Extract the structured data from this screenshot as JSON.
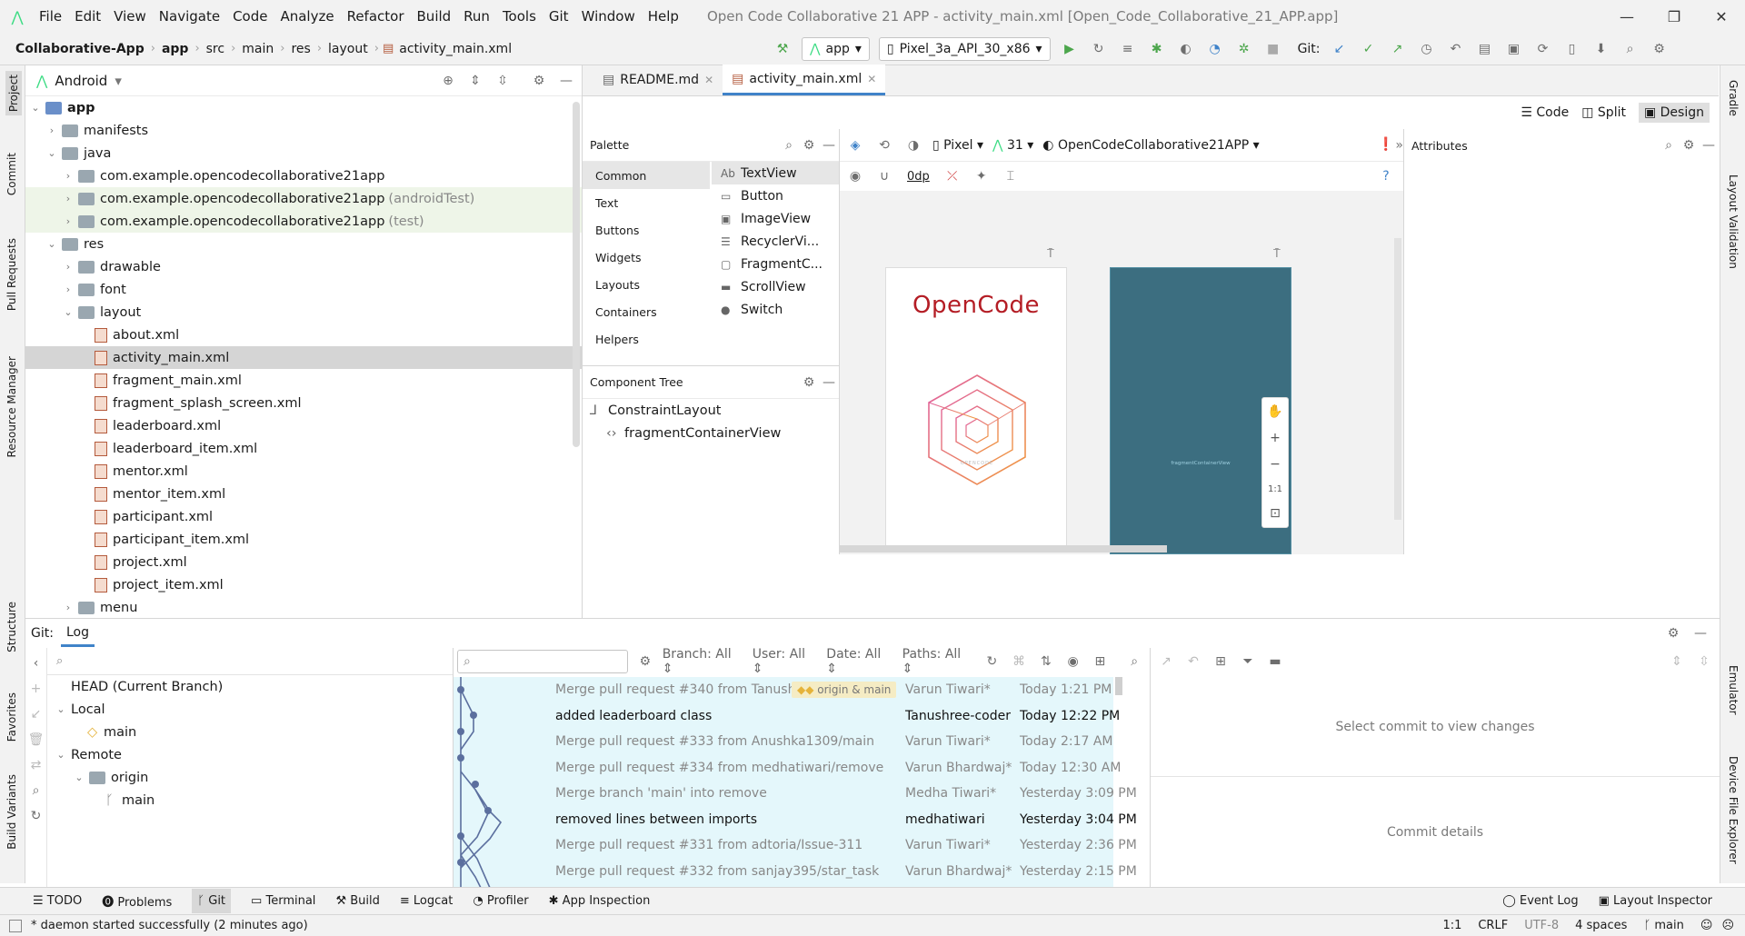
{
  "menu": {
    "items": [
      "File",
      "Edit",
      "View",
      "Navigate",
      "Code",
      "Analyze",
      "Refactor",
      "Build",
      "Run",
      "Tools",
      "Git",
      "Window",
      "Help"
    ],
    "title": "Open Code Collaborative 21 APP - activity_main.xml [Open_Code_Collaborative_21_APP.app]"
  },
  "nav": {
    "crumbs": [
      "Collaborative-App",
      "app",
      "src",
      "main",
      "res",
      "layout",
      "activity_main.xml"
    ],
    "run_config": "app",
    "device": "Pixel_3a_API_30_x86",
    "git_label": "Git:"
  },
  "left_stripe": [
    "Project",
    "Commit",
    "Pull Requests",
    "Resource Manager",
    "Structure",
    "Favorites",
    "Build Variants"
  ],
  "right_stripe": [
    "Gradle",
    "Layout Validation",
    "Emulator",
    "Device File Explorer"
  ],
  "project": {
    "view": "Android",
    "tree": [
      {
        "label": "app",
        "depth": 0,
        "icon": "folder",
        "open": true,
        "bold": true
      },
      {
        "label": "manifests",
        "depth": 1,
        "icon": "folder",
        "open": false
      },
      {
        "label": "java",
        "depth": 1,
        "icon": "folder",
        "open": true
      },
      {
        "label": "com.example.opencodecollaborative21app",
        "depth": 2,
        "icon": "pkg",
        "open": false
      },
      {
        "label": "com.example.opencodecollaborative21app",
        "suffix": "(androidTest)",
        "depth": 2,
        "icon": "pkg",
        "open": false,
        "green": true
      },
      {
        "label": "com.example.opencodecollaborative21app",
        "suffix": "(test)",
        "depth": 2,
        "icon": "pkg",
        "open": false,
        "green": true
      },
      {
        "label": "res",
        "depth": 1,
        "icon": "folder",
        "open": true
      },
      {
        "label": "drawable",
        "depth": 2,
        "icon": "folder",
        "open": false
      },
      {
        "label": "font",
        "depth": 2,
        "icon": "folder",
        "open": false
      },
      {
        "label": "layout",
        "depth": 2,
        "icon": "folder",
        "open": true
      },
      {
        "label": "about.xml",
        "depth": 3,
        "icon": "xml"
      },
      {
        "label": "activity_main.xml",
        "depth": 3,
        "icon": "xml",
        "selected": true
      },
      {
        "label": "fragment_main.xml",
        "depth": 3,
        "icon": "xml"
      },
      {
        "label": "fragment_splash_screen.xml",
        "depth": 3,
        "icon": "xml"
      },
      {
        "label": "leaderboard.xml",
        "depth": 3,
        "icon": "xml"
      },
      {
        "label": "leaderboard_item.xml",
        "depth": 3,
        "icon": "xml"
      },
      {
        "label": "mentor.xml",
        "depth": 3,
        "icon": "xml"
      },
      {
        "label": "mentor_item.xml",
        "depth": 3,
        "icon": "xml"
      },
      {
        "label": "participant.xml",
        "depth": 3,
        "icon": "xml"
      },
      {
        "label": "participant_item.xml",
        "depth": 3,
        "icon": "xml"
      },
      {
        "label": "project.xml",
        "depth": 3,
        "icon": "xml"
      },
      {
        "label": "project_item.xml",
        "depth": 3,
        "icon": "xml"
      },
      {
        "label": "menu",
        "depth": 2,
        "icon": "folder",
        "open": false
      }
    ]
  },
  "editor": {
    "tabs": [
      {
        "label": "README.md",
        "active": false
      },
      {
        "label": "activity_main.xml",
        "active": true
      }
    ],
    "modes": [
      "Code",
      "Split",
      "Design"
    ],
    "palette_title": "Palette",
    "palette_categories": [
      "Common",
      "Text",
      "Buttons",
      "Widgets",
      "Layouts",
      "Containers",
      "Helpers"
    ],
    "palette_widgets": [
      {
        "icon": "Ab",
        "label": "TextView"
      },
      {
        "icon": "▭",
        "label": "Button"
      },
      {
        "icon": "▣",
        "label": "ImageView"
      },
      {
        "icon": "☰",
        "label": "RecyclerVi..."
      },
      {
        "icon": "▢",
        "label": "FragmentC..."
      },
      {
        "icon": "▬",
        "label": "ScrollView"
      },
      {
        "icon": "●",
        "label": "Switch"
      }
    ],
    "component_tree_title": "Component Tree",
    "component_tree": [
      "ConstraintLayout",
      "fragmentContainerView"
    ],
    "design_toolbar": {
      "device": "Pixel",
      "api": "31",
      "theme": "OpenCodeCollaborative21APP",
      "margin": "0dp"
    },
    "preview_text": "OpenCode",
    "blueprint_label": "fragmentContainerView",
    "logo_caption": "OPENCODE",
    "zoom_fit": "1:1",
    "attributes_title": "Attributes"
  },
  "git": {
    "tab_prefix": "Git:",
    "tab_label": "Log",
    "branches": {
      "head": "HEAD (Current Branch)",
      "local": "Local",
      "local_main": "main",
      "remote": "Remote",
      "origin": "origin",
      "origin_main": "main"
    },
    "filters": {
      "branch": "Branch: All",
      "user": "User: All",
      "date": "Date: All",
      "paths": "Paths: All"
    },
    "commits": [
      {
        "msg": "Merge pull request #340 from Tanushree-coder/mai",
        "tag": "origin & main",
        "author": "Varun Tiwari*",
        "date": "Today 1:21 PM",
        "bold": false
      },
      {
        "msg": "added leaderboard class",
        "author": "Tanushree-coder",
        "date": "Today 12:22 PM",
        "bold": true
      },
      {
        "msg": "Merge pull request #333 from Anushka1309/main",
        "author": "Varun Tiwari*",
        "date": "Today 2:17 AM",
        "bold": false
      },
      {
        "msg": "Merge pull request #334 from medhatiwari/remove",
        "author": "Varun Bhardwaj*",
        "date": "Today 12:30 AM",
        "bold": false
      },
      {
        "msg": "Merge branch 'main' into remove",
        "author": "Medha Tiwari*",
        "date": "Yesterday 3:09 PM",
        "bold": false
      },
      {
        "msg": "removed lines between imports",
        "author": "medhatiwari",
        "date": "Yesterday 3:04 PM",
        "bold": true
      },
      {
        "msg": "Merge pull request #331 from adtoria/Issue-311",
        "author": "Varun Tiwari*",
        "date": "Yesterday 2:36 PM",
        "bold": false
      },
      {
        "msg": "Merge pull request #332 from sanjay395/star_task",
        "author": "Varun Bhardwaj*",
        "date": "Yesterday 2:15 PM",
        "bold": false
      }
    ],
    "select_hint": "Select commit to view changes",
    "commit_details": "Commit details"
  },
  "bottom_tools": [
    "TODO",
    "Problems",
    "Git",
    "Terminal",
    "Build",
    "Logcat",
    "Profiler",
    "App Inspection"
  ],
  "bottom_right_tools": [
    "Event Log",
    "Layout Inspector"
  ],
  "status": {
    "message": "* daemon started successfully (2 minutes ago)",
    "position": "1:1",
    "line_sep": "CRLF",
    "encoding": "UTF-8",
    "indent": "4 spaces",
    "branch": "main"
  },
  "colors": {
    "accent": "#4083c9",
    "blueprint": "#3c6e80",
    "opencode_text": "#b41d25",
    "git_highlight": "#e4f7fb",
    "run_green": "#4ca64c"
  }
}
